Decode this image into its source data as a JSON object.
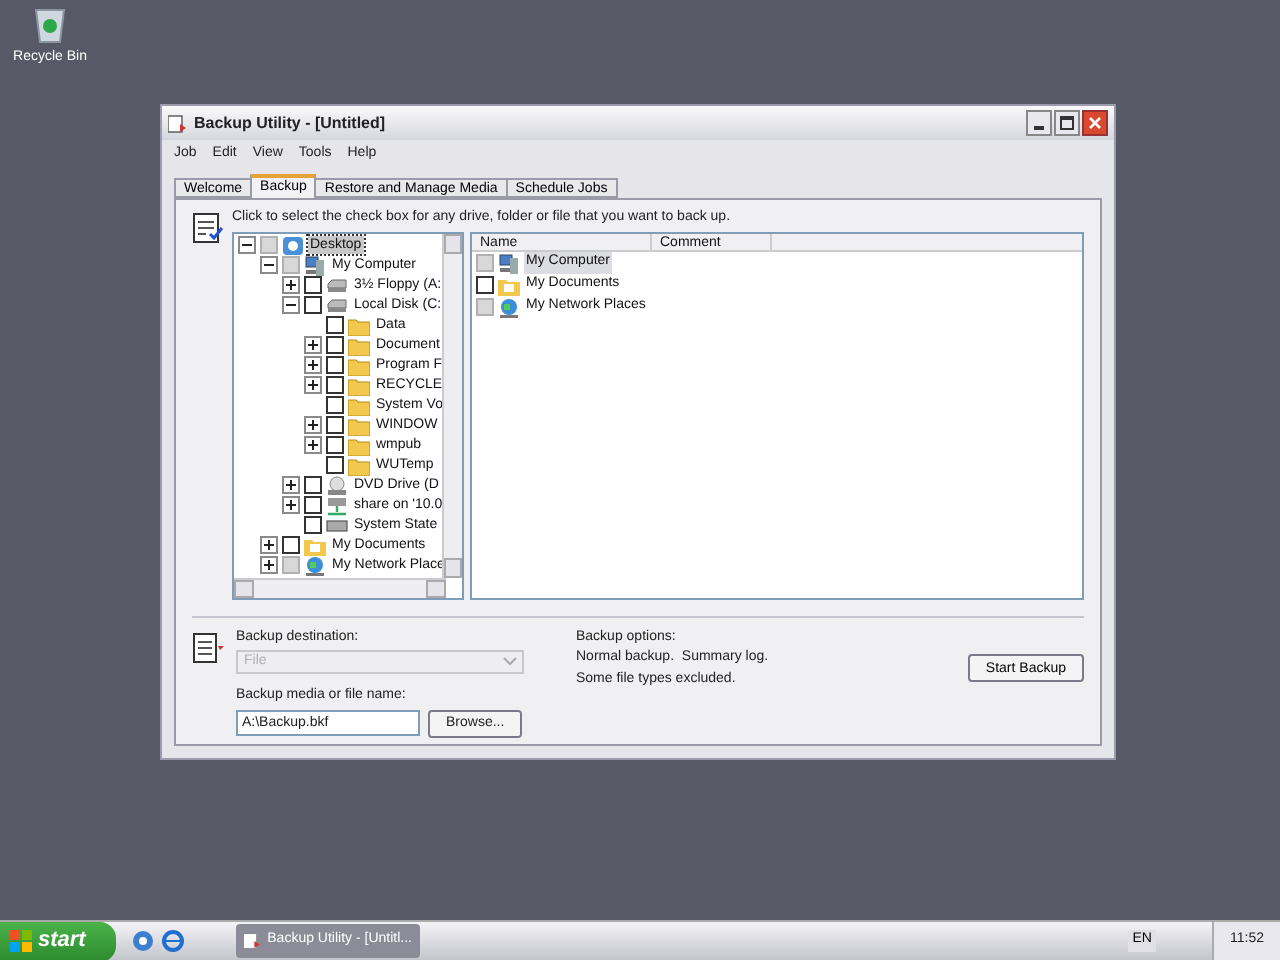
{
  "desktop_icons": [
    {
      "label": "Recycle Bin"
    }
  ],
  "window": {
    "title": "Backup Utility - [Untitled]"
  },
  "menu": [
    "Job",
    "Edit",
    "View",
    "Tools",
    "Help"
  ],
  "tabs": [
    {
      "label": "Welcome",
      "selected": false
    },
    {
      "label": "Backup",
      "selected": true
    },
    {
      "label": "Restore and Manage Media",
      "selected": false
    },
    {
      "label": "Schedule Jobs",
      "selected": false
    }
  ],
  "instruction": "Click to select the check box for any drive, folder or file that you want to back up.",
  "tree": [
    {
      "label": "Desktop",
      "kind": "desktop",
      "expanded": true,
      "grayed": true,
      "selected": true,
      "children": [
        {
          "label": "My Computer",
          "kind": "computer",
          "expanded": true,
          "grayed": true,
          "selected": false,
          "children": [
            {
              "label": "3½ Floppy (A:",
              "kind": "floppy",
              "expanded": false,
              "grayed": false,
              "selected": false
            },
            {
              "label": "Local Disk (C:",
              "kind": "disk",
              "expanded": true,
              "grayed": false,
              "selected": false,
              "children": [
                {
                  "label": "Data",
                  "kind": "folder",
                  "grayed": false,
                  "selected": false
                },
                {
                  "label": "Document",
                  "kind": "folder",
                  "expanded": false,
                  "grayed": false,
                  "selected": false
                },
                {
                  "label": "Program F",
                  "kind": "folder",
                  "expanded": false,
                  "grayed": false,
                  "selected": false
                },
                {
                  "label": "RECYCLE",
                  "kind": "folder",
                  "expanded": false,
                  "grayed": false,
                  "selected": false
                },
                {
                  "label": "System Vo",
                  "kind": "folder",
                  "grayed": false,
                  "selected": false
                },
                {
                  "label": "WINDOW",
                  "kind": "folder",
                  "expanded": false,
                  "grayed": false,
                  "selected": false
                },
                {
                  "label": "wmpub",
                  "kind": "folder",
                  "expanded": false,
                  "grayed": false,
                  "selected": false
                },
                {
                  "label": "WUTemp",
                  "kind": "folder",
                  "grayed": false,
                  "selected": false
                }
              ]
            },
            {
              "label": "DVD Drive (D",
              "kind": "dvd",
              "expanded": false,
              "grayed": false,
              "selected": false
            },
            {
              "label": "share on '10.0",
              "kind": "network-drive",
              "expanded": false,
              "grayed": false,
              "selected": false
            },
            {
              "label": "System State",
              "kind": "system-state",
              "grayed": false,
              "selected": false
            }
          ]
        },
        {
          "label": "My Documents",
          "kind": "documents",
          "expanded": false,
          "grayed": false,
          "selected": false
        },
        {
          "label": "My Network Place",
          "kind": "network",
          "expanded": false,
          "grayed": true,
          "selected": false
        }
      ]
    }
  ],
  "list": {
    "columns": [
      "Name",
      "Comment"
    ],
    "items": [
      {
        "name": "My Computer",
        "kind": "computer",
        "grayed": true,
        "selected": true
      },
      {
        "name": "My Documents",
        "kind": "documents",
        "grayed": false,
        "selected": false
      },
      {
        "name": "My Network Places",
        "kind": "network",
        "grayed": true,
        "selected": false
      }
    ]
  },
  "destination": {
    "label": "Backup destination:",
    "value": "File",
    "disabled": true
  },
  "media": {
    "label": "Backup media or file name:",
    "value": "A:\\Backup.bkf",
    "button": "Browse..."
  },
  "options": {
    "label": "Backup options:",
    "lines": [
      "Normal backup.  Summary log.",
      "Some file types excluded."
    ]
  },
  "start_button": "Start Backup",
  "taskbar": {
    "start": "start",
    "tasks": [
      {
        "label": "Backup Utility - [Untitl...",
        "selected": false
      }
    ],
    "language": "EN",
    "clock": "11:52"
  }
}
